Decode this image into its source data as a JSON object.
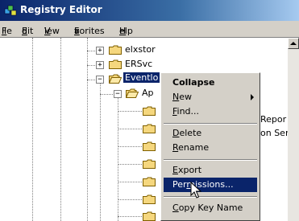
{
  "window": {
    "title": "Registry Editor"
  },
  "menu": [
    {
      "pre": "",
      "ul": "F",
      "post": "ile"
    },
    {
      "pre": "",
      "ul": "E",
      "post": "dit"
    },
    {
      "pre": "",
      "ul": "V",
      "post": "iew"
    },
    {
      "pre": "F",
      "ul": "a",
      "post": "vorites"
    },
    {
      "pre": "",
      "ul": "H",
      "post": "elp"
    }
  ],
  "tree": {
    "items": [
      "elxstor",
      "ERSvc",
      "Eventlo",
      "Ap"
    ],
    "right_text": [
      "Repor",
      "on Ser"
    ]
  },
  "context_menu": {
    "collapse": "Collapse",
    "new": {
      "ul": "N",
      "rest": "ew"
    },
    "find": {
      "ul": "F",
      "rest": "ind..."
    },
    "delete": {
      "ul": "D",
      "rest": "elete"
    },
    "rename": {
      "ul": "R",
      "rest": "ename"
    },
    "export": {
      "ul": "E",
      "rest": "xport"
    },
    "permissions": {
      "pre": "Per",
      "ul": "m",
      "rest": "issions..."
    },
    "copy_key": {
      "ul": "C",
      "rest": "opy Key Name"
    }
  },
  "colors": {
    "selection": "#0a246a",
    "titlebar": "#0a246a",
    "face": "#d4d0c8"
  }
}
